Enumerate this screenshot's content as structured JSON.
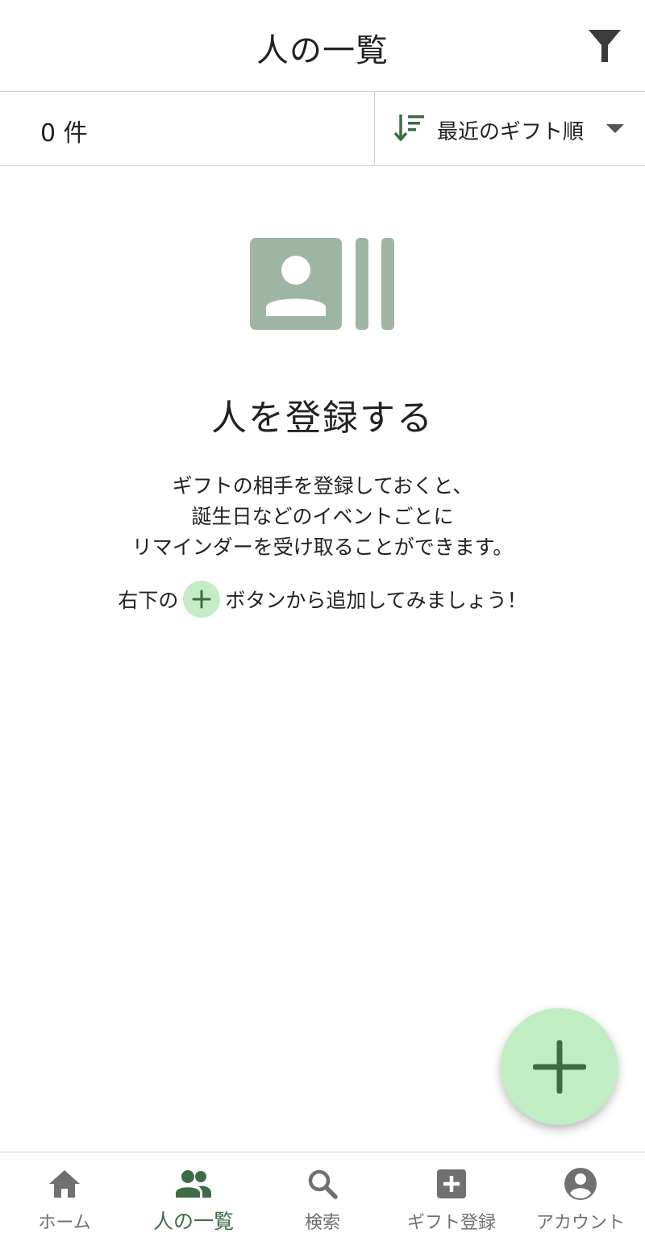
{
  "header": {
    "title": "人の一覧",
    "filter_icon": "filter-icon"
  },
  "toolbar": {
    "count": "0 件",
    "sort_label": "最近のギフト順",
    "sort_icon": "sort-icon",
    "caret_icon": "caret-down-icon"
  },
  "empty_state": {
    "illustration": "contacts-icon",
    "title": "人を登録する",
    "description": [
      "ギフトの相手を登録しておくと、",
      "誕生日などのイベントごとに",
      "リマインダーを受け取ることができます。"
    ],
    "hint_before": "右下の",
    "hint_after": "ボタンから追加してみましょう！"
  },
  "fab": {
    "icon": "plus-icon"
  },
  "bottom_nav": {
    "items": [
      {
        "label": "ホーム",
        "icon": "home-icon",
        "active": false
      },
      {
        "label": "人の一覧",
        "icon": "people-icon",
        "active": true
      },
      {
        "label": "検索",
        "icon": "search-icon",
        "active": false
      },
      {
        "label": "ギフト登録",
        "icon": "add-box-icon",
        "active": false
      },
      {
        "label": "アカウント",
        "icon": "account-circle-icon",
        "active": false
      }
    ]
  },
  "colors": {
    "accent_dark": "#3e6b45",
    "accent_light": "#c1edc3",
    "illustration": "#9fb5a3",
    "inactive": "#707070"
  }
}
